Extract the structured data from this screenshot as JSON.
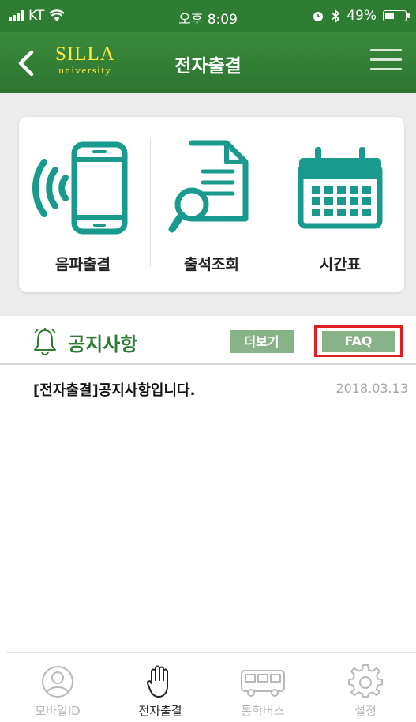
{
  "status_bar": {
    "carrier": "KT",
    "time": "오후 8:09",
    "battery_text": "49%",
    "battery_level": 0.49
  },
  "nav": {
    "logo_line1": "SILLA",
    "logo_line2": "university",
    "title": "전자출결"
  },
  "menu_cards": [
    {
      "label": "음파출결",
      "icon": "sound-wave-phone-icon"
    },
    {
      "label": "출석조회",
      "icon": "document-search-icon"
    },
    {
      "label": "시간표",
      "icon": "calendar-icon"
    }
  ],
  "notice": {
    "title": "공지사항",
    "more_label": "더보기",
    "faq_label": "FAQ",
    "items": [
      {
        "text": "[전자출결]공지사항입니다.",
        "date": "2018.03.13"
      }
    ]
  },
  "tabs": [
    {
      "label": "모바일ID",
      "icon": "person-icon",
      "active": false
    },
    {
      "label": "전자출결",
      "icon": "hand-icon",
      "active": true
    },
    {
      "label": "통학버스",
      "icon": "bus-icon",
      "active": false
    },
    {
      "label": "설정",
      "icon": "gear-icon",
      "active": false
    }
  ],
  "colors": {
    "brand_green": "#2e7d32",
    "teal_icon": "#1a9a8c",
    "button_green": "#88b287",
    "highlight_red": "#e02020"
  }
}
